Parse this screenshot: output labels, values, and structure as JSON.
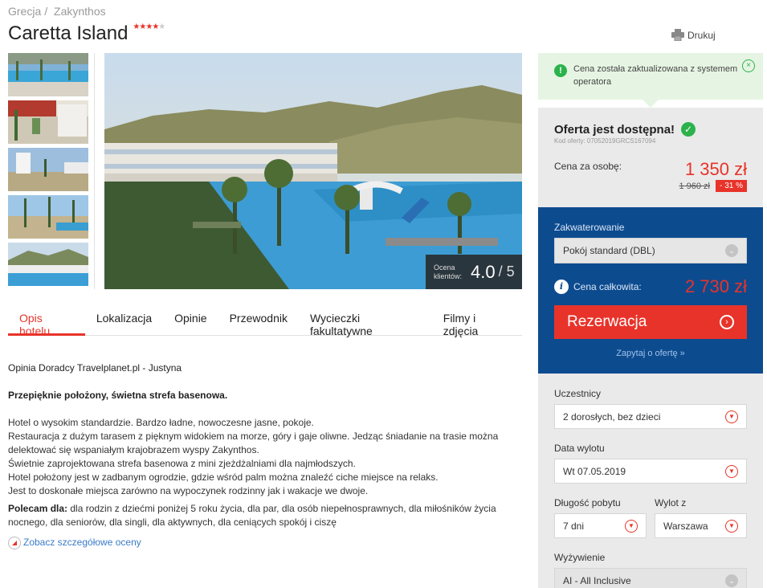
{
  "breadcrumb": [
    "Grecja",
    "Zakynthos"
  ],
  "breadcrumb_sep": "/",
  "hotel": {
    "name": "Caretta Island",
    "stars": 4
  },
  "print_label": "Drukuj",
  "rating": {
    "label": "Ocena klientów:",
    "value": "4.0",
    "max": "/ 5"
  },
  "tabs": [
    {
      "label": "Opis hotelu",
      "active": true
    },
    {
      "label": "Lokalizacja",
      "active": false
    },
    {
      "label": "Opinie",
      "active": false
    },
    {
      "label": "Przewodnik",
      "active": false
    },
    {
      "label": "Wycieczki fakultatywne",
      "active": false
    },
    {
      "label": "Filmy i zdjęcia",
      "active": false
    }
  ],
  "content": {
    "advisor": "Opinia Doradcy Travelplanet.pl - Justyna",
    "tagline": "Przepięknie położony, świetna strefa basenowa.",
    "paragraphs": [
      "Hotel o wysokim standardzie. Bardzo ładne, nowoczesne jasne, pokoje.",
      "Restauracja z dużym tarasem z pięknym widokiem na morze, góry i gaje oliwne. Jedząc śniadanie na trasie można delektować się wspaniałym krajobrazem wyspy Zakynthos.",
      "Świetnie zaprojektowana strefa basenowa z mini zjeżdżalniami dla najmłodszych.",
      "Hotel położony jest w zadbanym ogrodzie, gdzie wśród palm można znaleźć ciche miejsce na relaks.",
      "Jest to doskonałe miejsca zarówno na wypoczynek rodzinny jak i wakacje we dwoje."
    ],
    "recommend_label": "Polecam dla:",
    "recommend_text": " dla rodzin z dziećmi poniżej 5 roku życia, dla par, dla osób niepełnosprawnych, dla miłośników życia nocnego, dla seniorów, dla singli, dla aktywnych, dla ceniących spokój i ciszę",
    "details_link": "Zobacz szczegółowe oceny"
  },
  "notice": {
    "text": "Cena została zaktualizowana z systemem operatora",
    "close": "×"
  },
  "offer": {
    "title": "Oferta jest dostępna!",
    "code": "Kod oferty: 07052019GRCS167094",
    "price_label": "Cena za osobę:",
    "price": "1 350 zł",
    "old_price": "1 960 zł",
    "discount": "- 31 %"
  },
  "booking": {
    "accommodation_label": "Zakwaterowanie",
    "accommodation_value": "Pokój standard (DBL)",
    "total_label": "Cena całkowita:",
    "total_price": "2 730 zł",
    "reserve_label": "Rezerwacja",
    "ask_link": "Zapytaj o ofertę »"
  },
  "filters": {
    "participants_label": "Uczestnicy",
    "participants_value": "2 dorosłych, bez dzieci",
    "departure_label": "Data wylotu",
    "departure_value": "Wt 07.05.2019",
    "duration_label": "Długość pobytu",
    "duration_value": "7 dni",
    "from_label": "Wylot z",
    "from_value": "Warszawa",
    "board_label": "Wyżywienie",
    "board_value": "AI - All Inclusive"
  },
  "colors": {
    "accent": "#e8332a",
    "booking_bg": "#0d4b8f",
    "success": "#2bb24c",
    "link": "#3a7bc8"
  }
}
